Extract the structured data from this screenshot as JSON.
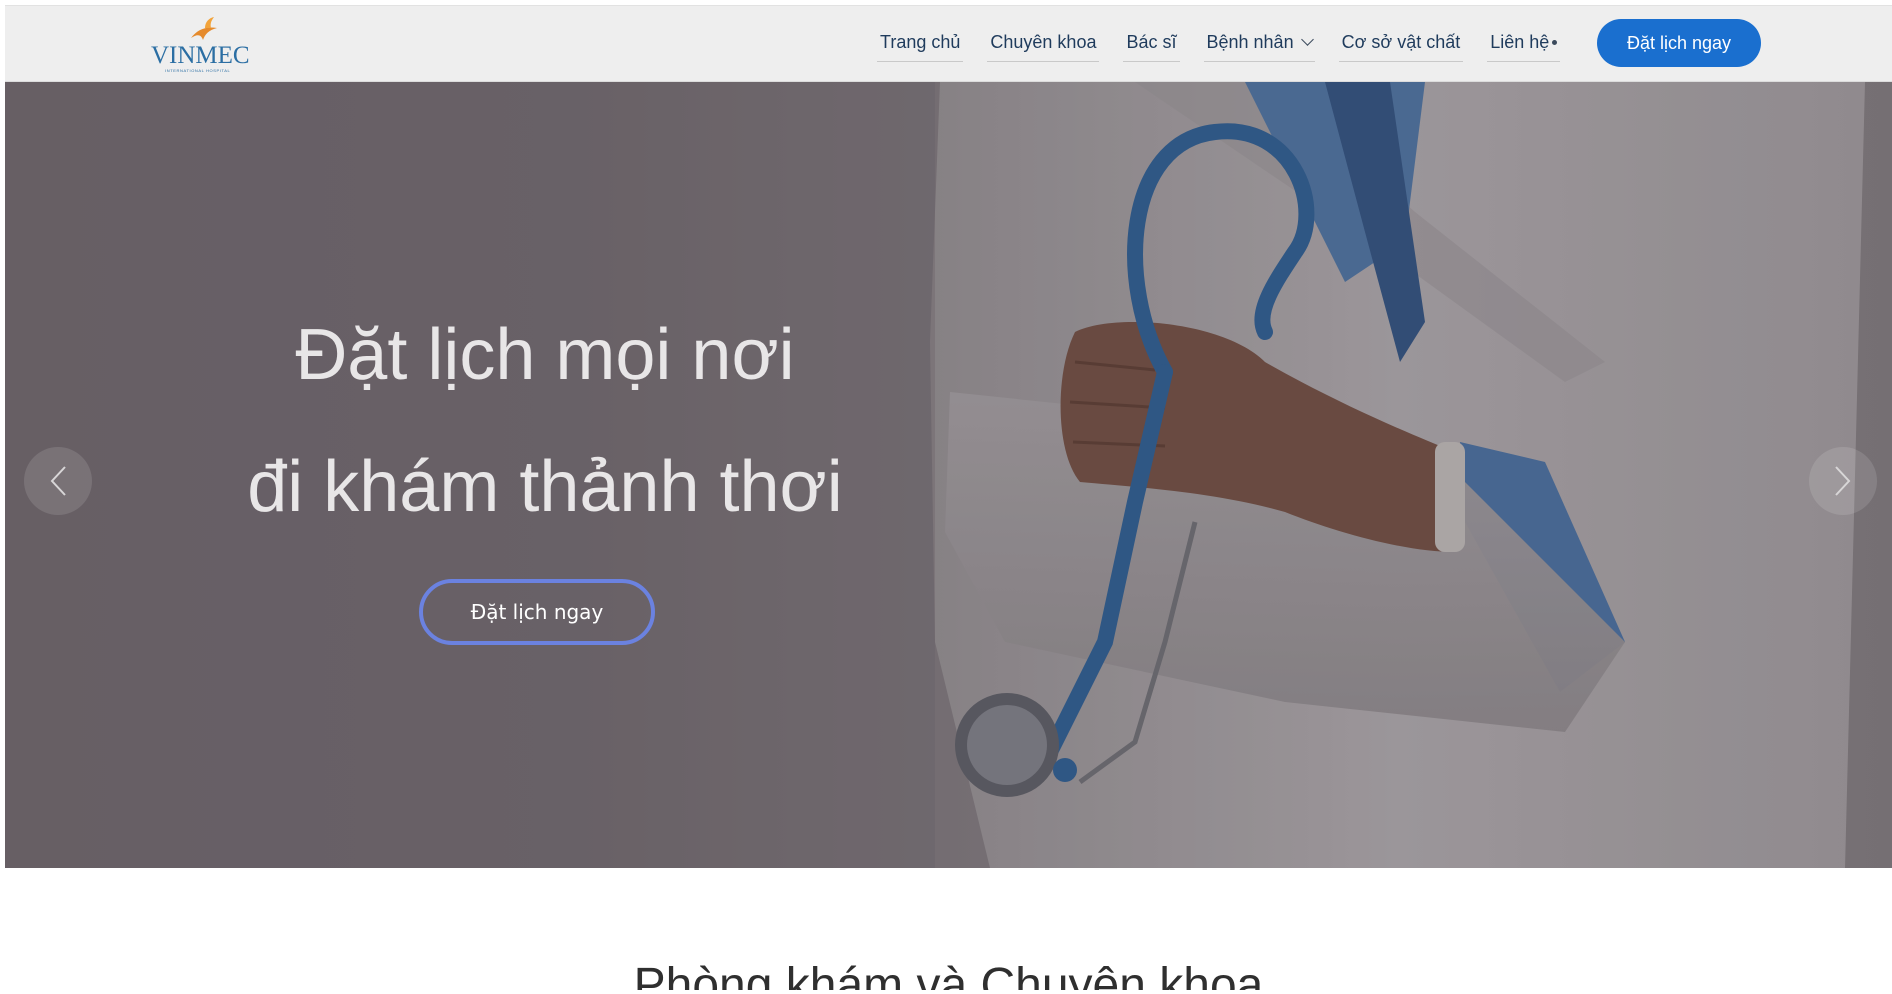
{
  "header": {
    "logo": {
      "text": "VINMEC",
      "subtitle": "International Hospital"
    },
    "nav": [
      {
        "label": "Trang chủ"
      },
      {
        "label": "Chuyên khoa"
      },
      {
        "label": "Bác sĩ"
      },
      {
        "label": "Bệnh nhân",
        "icon": "chevron-down-icon"
      },
      {
        "label": "Cơ sở vật chất"
      },
      {
        "label": "Liên hệ",
        "icon": "dot-icon"
      }
    ],
    "cta_label": "Đặt lịch ngay"
  },
  "hero": {
    "title_line1": "Đặt lịch mọi nơi",
    "title_line2": "đi khám thảnh thơi",
    "cta_label": "Đặt lịch ngay",
    "prev_icon": "chevron-left-icon",
    "next_icon": "chevron-right-icon"
  },
  "section": {
    "title": "Phòng khám và Chuyên khoa"
  },
  "colors": {
    "primary": "#1a6fcf",
    "header_bg": "#eeeeee",
    "hero_outline": "#6b82e0",
    "nav_text": "#1f3b5c",
    "logo_blue": "#2b6ea3",
    "logo_orange": "#e58a2c"
  }
}
